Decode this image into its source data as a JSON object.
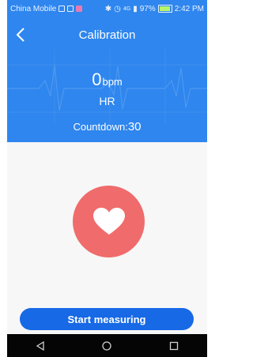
{
  "status_bar": {
    "carrier": "China Mobile",
    "signal_text": "4G",
    "battery": "97%",
    "time": "2:42 PM"
  },
  "header": {
    "title": "Calibration",
    "bpm_value": "0",
    "bpm_unit": "bpm",
    "hr_label": "HR",
    "countdown_label": "Countdown:",
    "countdown_value": "30"
  },
  "actions": {
    "start_label": "Start measuring"
  },
  "colors": {
    "primary_blue": "#2f86ee",
    "button_blue": "#1769e6",
    "heart_red": "#f06b6b"
  },
  "icons": {
    "back": "chevron-left-icon",
    "heart": "heart-icon",
    "nav_back": "triangle-back-icon",
    "nav_home": "circle-home-icon",
    "nav_recent": "square-recent-icon"
  }
}
